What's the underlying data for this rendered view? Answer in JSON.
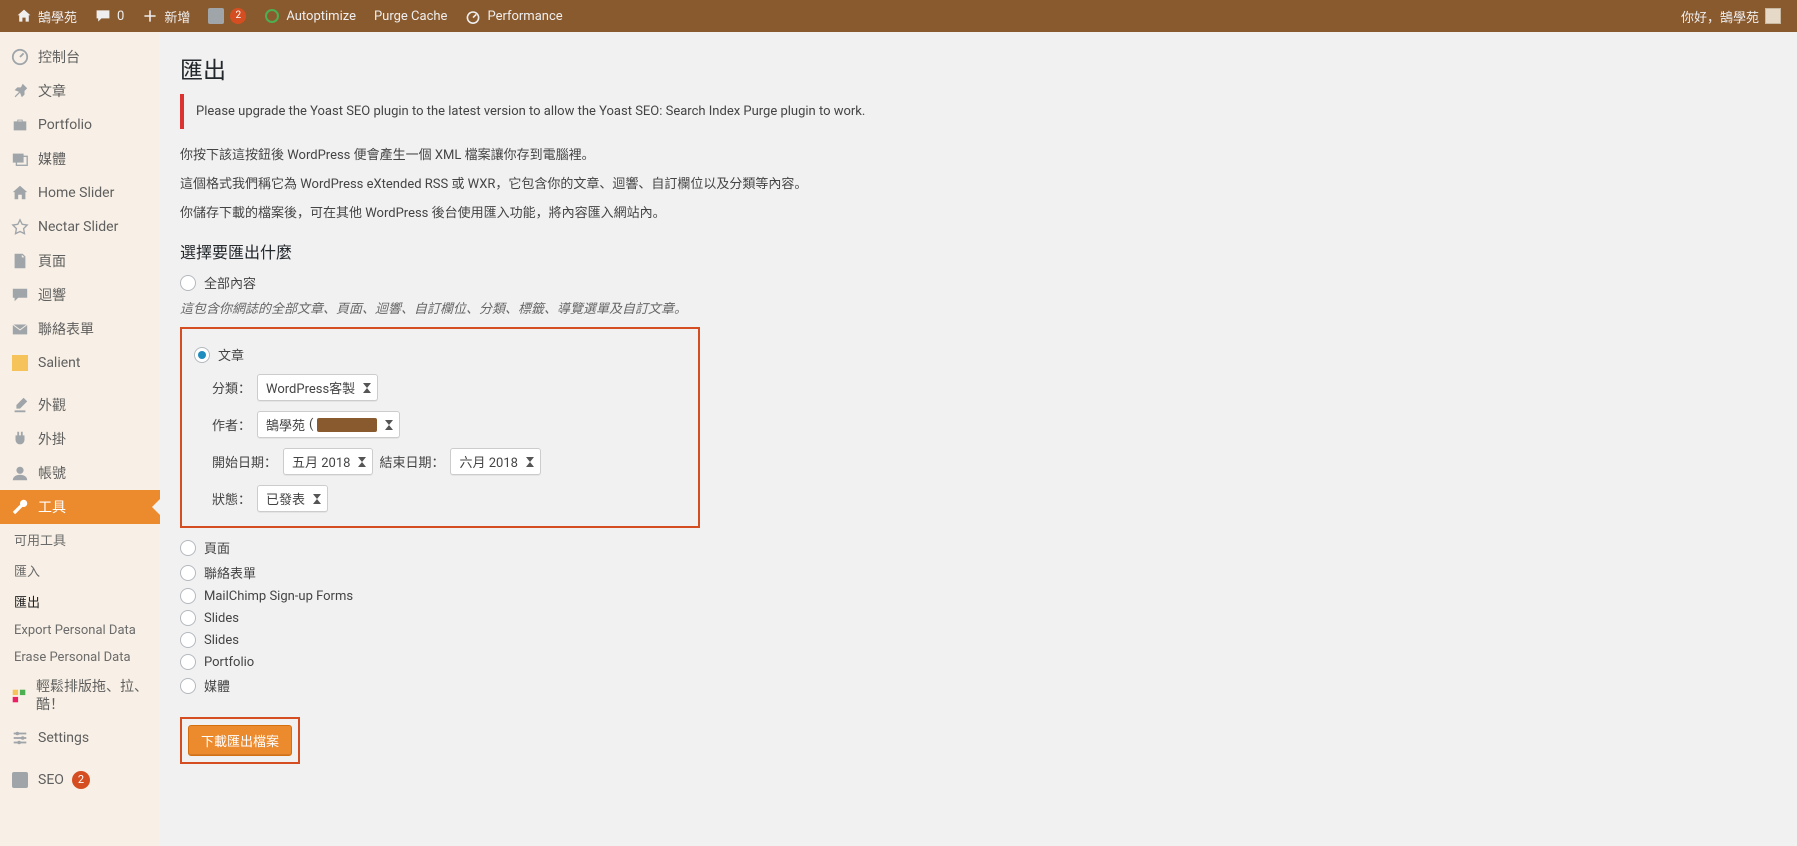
{
  "admin_bar": {
    "site_name": "鵠學苑",
    "comments_count": "0",
    "new_label": "新增",
    "update_count": "2",
    "autoptimize_label": "Autoptimize",
    "purge_cache_label": "Purge Cache",
    "performance_label": "Performance",
    "howdy": "你好，鵠學苑"
  },
  "sidebar": {
    "items": [
      {
        "id": "dashboard",
        "label": "控制台",
        "icon": "dashboard-icon"
      },
      {
        "id": "posts",
        "label": "文章",
        "icon": "pin-icon"
      },
      {
        "id": "portfolio",
        "label": "Portfolio",
        "icon": "briefcase-icon"
      },
      {
        "id": "media",
        "label": "媒體",
        "icon": "media-icon"
      },
      {
        "id": "home-slider",
        "label": "Home Slider",
        "icon": "home-icon"
      },
      {
        "id": "nectar-slider",
        "label": "Nectar Slider",
        "icon": "star-icon"
      },
      {
        "id": "pages",
        "label": "頁面",
        "icon": "page-icon"
      },
      {
        "id": "comments",
        "label": "迴響",
        "icon": "comment-icon"
      },
      {
        "id": "contact",
        "label": "聯絡表單",
        "icon": "mail-icon"
      },
      {
        "id": "salient",
        "label": "Salient",
        "icon": "salient-icon"
      },
      {
        "id": "appearance",
        "label": "外觀",
        "icon": "brush-icon"
      },
      {
        "id": "plugins",
        "label": "外掛",
        "icon": "plug-icon"
      },
      {
        "id": "users",
        "label": "帳號",
        "icon": "user-icon"
      },
      {
        "id": "tools",
        "label": "工具",
        "icon": "wrench-icon"
      },
      {
        "id": "settings",
        "label": "Settings",
        "icon": "settings-icon"
      },
      {
        "id": "seo",
        "label": "SEO",
        "icon": "yoast-icon",
        "badge": "2"
      }
    ],
    "submenu": [
      {
        "id": "available",
        "label": "可用工具"
      },
      {
        "id": "import",
        "label": "匯入"
      },
      {
        "id": "export",
        "label": "匯出"
      },
      {
        "id": "export-personal",
        "label": "Export Personal Data"
      },
      {
        "id": "erase-personal",
        "label": "Erase Personal Data"
      }
    ],
    "extra": {
      "label": "輕鬆排版拖、拉、酷！"
    }
  },
  "main": {
    "title": "匯出",
    "notice": "Please upgrade the Yoast SEO plugin to the latest version to allow the Yoast SEO: Search Index Purge plugin to work.",
    "desc1": "你按下該這按鈕後 WordPress 便會產生一個 XML 檔案讓你存到電腦裡。",
    "desc2": "這個格式我們稱它為 WordPress eXtended RSS 或 WXR，它包含你的文章、迴響、自訂欄位以及分類等內容。",
    "desc3": "你儲存下載的檔案後，可在其他 WordPress 後台使用匯入功能，將內容匯入網站內。",
    "choose_heading": "選擇要匯出什麼",
    "opt_all": "全部內容",
    "hint_all": "這包含你網誌的全部文章、頁面、迴響、自訂欄位、分類、標籤、導覽選單及自訂文章。",
    "opt_posts": "文章",
    "filters": {
      "category_label": "分類：",
      "category_value": "WordPress客製",
      "author_label": "作者：",
      "author_value": "鵠學苑",
      "start_label": "開始日期：",
      "start_value": "五月 2018",
      "end_label": "結束日期：",
      "end_value": "六月 2018",
      "status_label": "狀態：",
      "status_value": "已發表"
    },
    "opt_pages": "頁面",
    "opt_contact": "聯絡表單",
    "opt_mailchimp": "MailChimp Sign-up Forms",
    "opt_slides1": "Slides",
    "opt_slides2": "Slides",
    "opt_portfolio": "Portfolio",
    "opt_media": "媒體",
    "download_btn": "下載匯出檔案"
  }
}
